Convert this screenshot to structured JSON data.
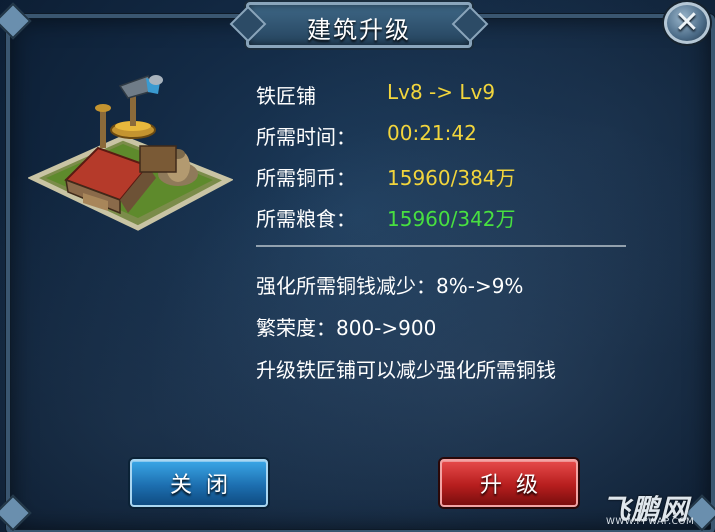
{
  "dialog": {
    "title": "建筑升级",
    "close_icon": "close-x-icon"
  },
  "building": {
    "image": "blacksmith-building-illustration"
  },
  "details": {
    "name_label": "铁匠铺",
    "level_value": "Lv8 -> Lv9",
    "time_label": "所需时间：",
    "time_value": "00:21:42",
    "copper_label": "所需铜币：",
    "copper_value": "15960/384万",
    "grain_label": "所需粮食：",
    "grain_value": "15960/342万"
  },
  "effects": {
    "line1": "强化所需铜钱减少：8%->9%",
    "line2": "繁荣度：800->900",
    "line3": "升级铁匠铺可以减少强化所需铜钱"
  },
  "buttons": {
    "close_label": "关闭",
    "upgrade_label": "升级"
  },
  "watermark": {
    "text": "飞鹏网",
    "url": "WWW.FPWAP.COM"
  },
  "colors": {
    "value_yellow": "#f2d53c",
    "value_green": "#48e040",
    "button_blue": "#1d6fb0",
    "button_red": "#b71e1e"
  }
}
